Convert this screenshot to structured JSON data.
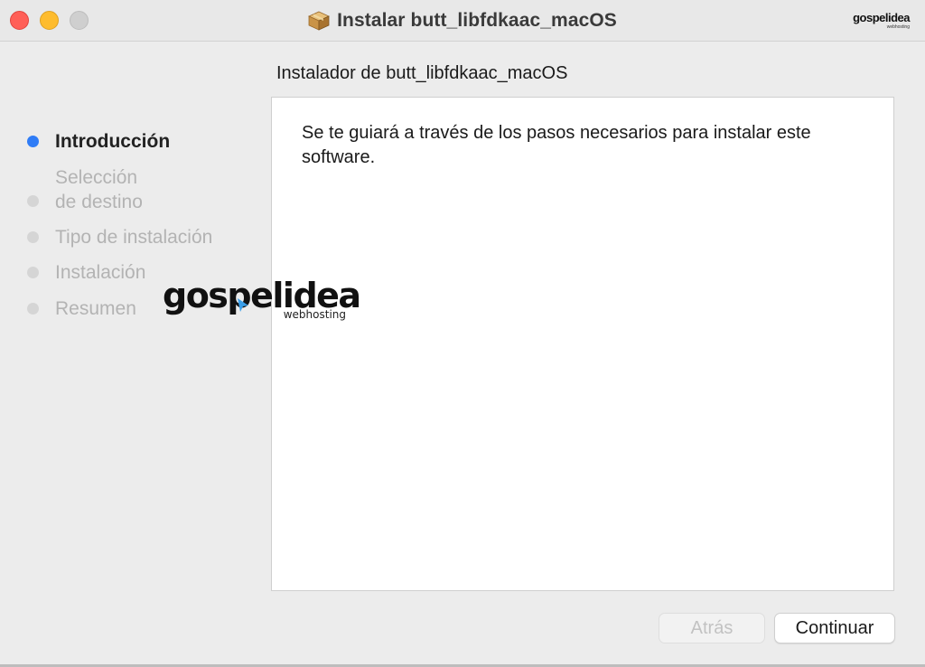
{
  "window": {
    "title": "Instalar butt_libfdkaac_macOS",
    "icon": "package-icon",
    "brand": {
      "main": "gospelidea",
      "sub": "webhosting"
    }
  },
  "header": {
    "heading": "Instalador de butt_libfdkaac_macOS"
  },
  "sidebar": {
    "steps": [
      {
        "label": "Introducción",
        "active": true
      },
      {
        "label": "Selección\nde destino",
        "active": false
      },
      {
        "label": "Tipo de instalación",
        "active": false
      },
      {
        "label": "Instalación",
        "active": false
      },
      {
        "label": "Resumen",
        "active": false
      }
    ]
  },
  "content": {
    "text": "Se te guiará a través de los pasos necesarios para instalar este software."
  },
  "watermark": {
    "main": "gospelidea",
    "sub": "webhosting"
  },
  "buttons": {
    "back": "Atrás",
    "continue": "Continuar"
  },
  "colors": {
    "accent": "#2f7cf6",
    "close": "#ff5f57",
    "minimize": "#febc2e"
  }
}
